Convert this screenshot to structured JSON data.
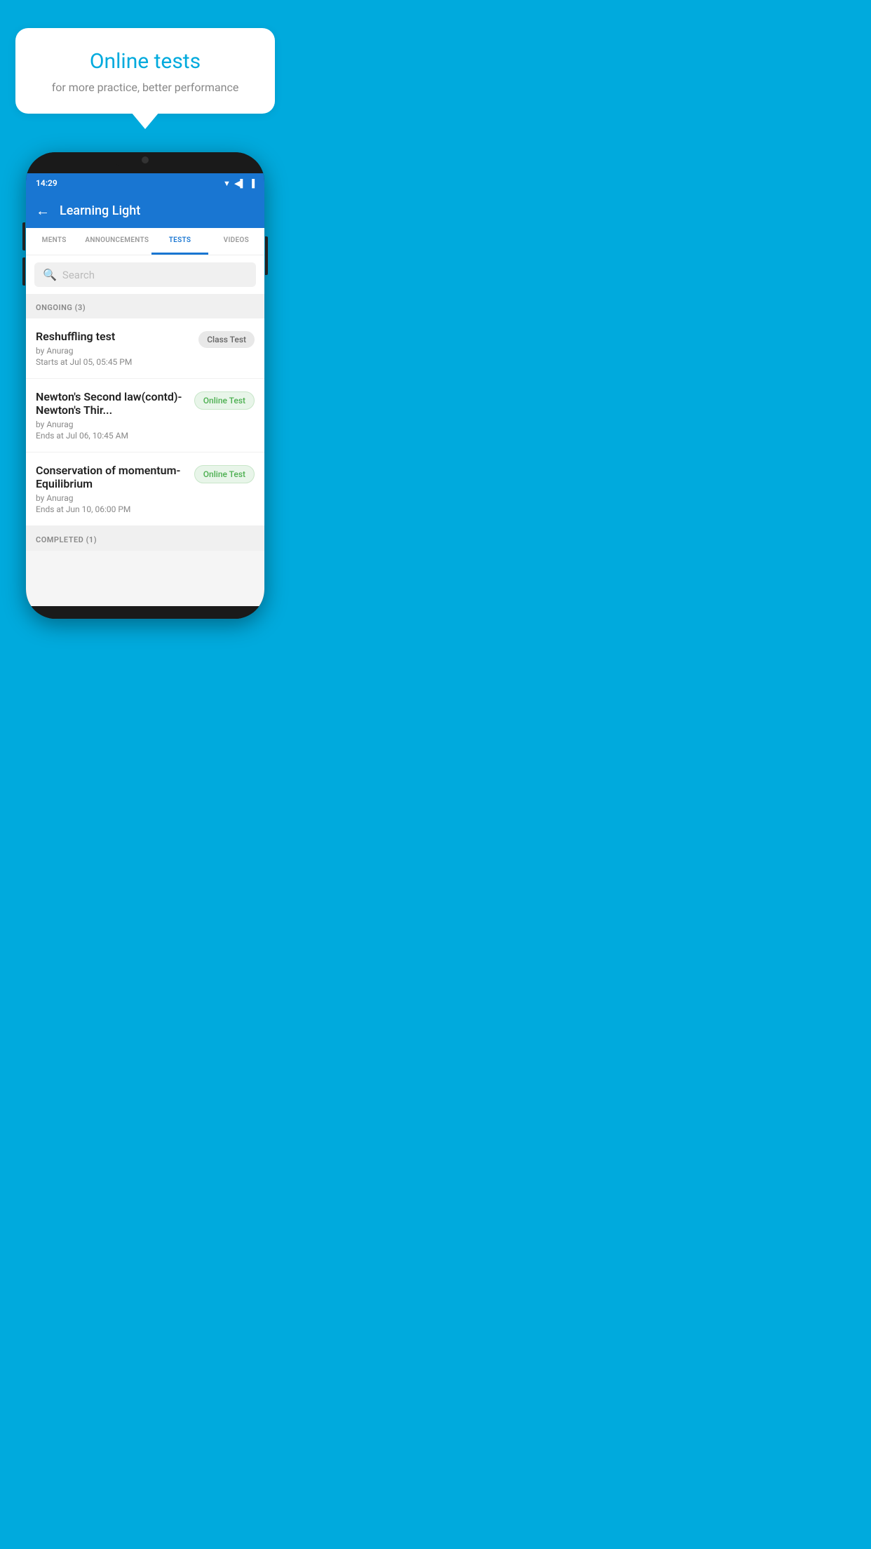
{
  "promo": {
    "title": "Online tests",
    "subtitle": "for more practice, better performance"
  },
  "status_bar": {
    "time": "14:29",
    "icons": [
      "wifi",
      "signal",
      "battery"
    ]
  },
  "app_header": {
    "title": "Learning Light",
    "back_label": "←"
  },
  "tabs": [
    {
      "id": "ments",
      "label": "MENTS",
      "active": false
    },
    {
      "id": "announcements",
      "label": "ANNOUNCEMENTS",
      "active": false
    },
    {
      "id": "tests",
      "label": "TESTS",
      "active": true
    },
    {
      "id": "videos",
      "label": "VIDEOS",
      "active": false
    }
  ],
  "search": {
    "placeholder": "Search"
  },
  "ongoing_section": {
    "label": "ONGOING (3)"
  },
  "tests": [
    {
      "name": "Reshuffling test",
      "author": "by Anurag",
      "time": "Starts at  Jul 05, 05:45 PM",
      "badge": "Class Test",
      "badge_type": "class"
    },
    {
      "name": "Newton's Second law(contd)-Newton's Thir...",
      "author": "by Anurag",
      "time": "Ends at  Jul 06, 10:45 AM",
      "badge": "Online Test",
      "badge_type": "online"
    },
    {
      "name": "Conservation of momentum-Equilibrium",
      "author": "by Anurag",
      "time": "Ends at  Jun 10, 06:00 PM",
      "badge": "Online Test",
      "badge_type": "online"
    }
  ],
  "completed_section": {
    "label": "COMPLETED (1)"
  },
  "colors": {
    "background": "#00AADD",
    "header_blue": "#1976D2",
    "tab_active": "#1976D2"
  }
}
